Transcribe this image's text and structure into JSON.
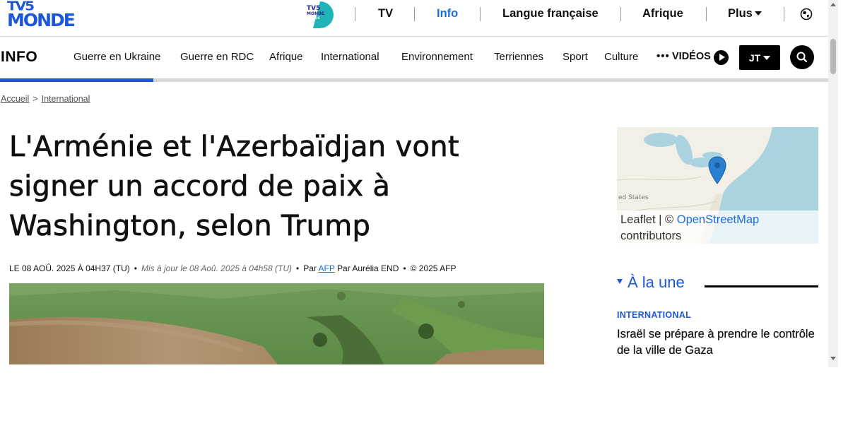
{
  "brand": {
    "logo_line1": "TV5",
    "logo_line2": "MONDE",
    "plus_logo_text_1": "TV5",
    "plus_logo_text_2": "MONDE",
    "plus_logo_text_3": "PLUS",
    "blue": "#1b57d6",
    "teal": "#21b4b7"
  },
  "top_nav": {
    "items": [
      {
        "label": "TV",
        "active": false
      },
      {
        "label": "Info",
        "active": true
      },
      {
        "label": "Langue française",
        "active": false
      },
      {
        "label": "Afrique",
        "active": false
      },
      {
        "label": "Plus",
        "active": false,
        "has_dropdown": true
      }
    ],
    "globe_icon": "globe-icon"
  },
  "section_nav": {
    "title": "INFO",
    "links": [
      "Guerre en Ukraine",
      "Guerre en RDC",
      "Afrique",
      "International",
      "Environnement",
      "Terriennes",
      "Sport",
      "Culture"
    ],
    "more_label": "•••",
    "videos_label": "VIDÉOS",
    "jt_label": "JT",
    "search_icon": "search-icon",
    "reading_progress": 0.185
  },
  "breadcrumb": {
    "home": "Accueil",
    "separator": ">",
    "section": "International"
  },
  "article": {
    "title": "L'Arménie et l'Azerbaïdjan vont signer un accord de paix à Washington, selon Trump",
    "published": "LE 08 AOÛ. 2025 À 04H37 (TU)",
    "updated": "Mis à jour le 08 Aoû. 2025 à 04h58 (TU)",
    "source_prefix": "Par",
    "source": "AFP",
    "author": "Par Aurélia END",
    "copyright": "© 2025 AFP",
    "bullet": "•"
  },
  "map": {
    "label": "ed States",
    "attribution_prefix": "Leaflet | ©",
    "attribution_link": "OpenStreetMap",
    "attribution_suffix": "contributors",
    "marker_icon": "map-marker-icon"
  },
  "a_la_une": {
    "heading": "À la une",
    "category": "INTERNATIONAL",
    "story": "Israël se prépare à prendre le contrôle de la ville de Gaza"
  }
}
